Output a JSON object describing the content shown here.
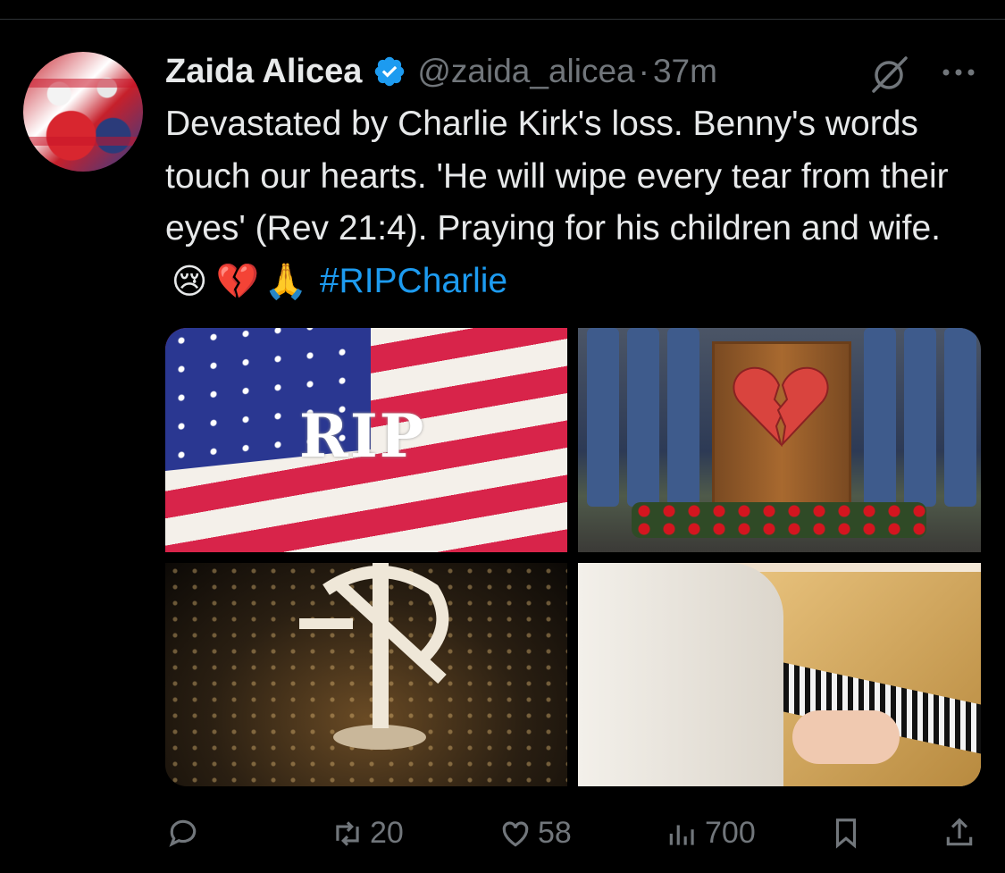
{
  "tweet": {
    "author_name": "Zaida Alicea",
    "handle": "@zaida_alicea",
    "separator": "·",
    "time": "37m",
    "text_main": "Devastated by Charlie Kirk's loss. Benny's words touch our hearts. 'He will wipe every tear from their eyes' (Rev 21:4). Praying for his children and wife. ",
    "emojis": [
      "😢",
      "💔",
      "🙏"
    ],
    "hashtag": "#RIPCharlie",
    "image_1_text": "RIP"
  },
  "metrics": {
    "retweets": "20",
    "likes": "58",
    "views": "700"
  },
  "colors": {
    "background": "#000000",
    "text": "#e7e9ea",
    "muted": "#71767b",
    "accent": "#1d9bf0"
  },
  "icons": [
    "verified-badge-icon",
    "grok-icon",
    "more-icon",
    "reply-icon",
    "retweet-icon",
    "like-icon",
    "views-icon",
    "bookmark-icon",
    "share-icon"
  ]
}
